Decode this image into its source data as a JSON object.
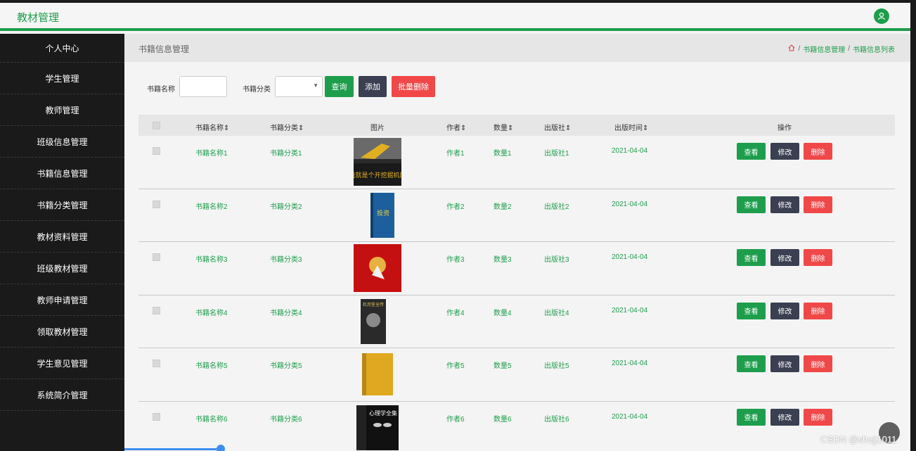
{
  "header": {
    "title": "教材管理"
  },
  "sidebar": {
    "items": [
      "个人中心",
      "学生管理",
      "教师管理",
      "班级信息管理",
      "书籍信息管理",
      "书籍分类管理",
      "教材资料管理",
      "班级教材管理",
      "教师申请管理",
      "领取教材管理",
      "学生意见管理",
      "系统简介管理"
    ]
  },
  "page": {
    "title": "书籍信息管理"
  },
  "breadcrumb": {
    "item1": "书籍信息管理",
    "separator": "/",
    "item2": "书籍信息列表"
  },
  "search": {
    "name_label": "书籍名称",
    "category_label": "书籍分类",
    "query_button": "查询",
    "add_button": "添加",
    "batch_delete_button": "批量删除"
  },
  "table": {
    "headers": [
      "书籍名称⇕",
      "书籍分类⇕",
      "图片",
      "作者⇕",
      "数量⇕",
      "出版社⇕",
      "出版时间⇕",
      "操作"
    ],
    "rows": [
      {
        "name": "书籍名称1",
        "category": "书籍分类1",
        "author": "作者1",
        "qty": "数量1",
        "publisher": "出版社1",
        "date": "2021-04-04",
        "cover_text": "我就是个开挖掘机的"
      },
      {
        "name": "书籍名称2",
        "category": "书籍分类2",
        "author": "作者2",
        "qty": "数量2",
        "publisher": "出版社2",
        "date": "2021-04-04",
        "cover_text": "投资"
      },
      {
        "name": "书籍名称3",
        "category": "书籍分类3",
        "author": "作者3",
        "qty": "数量3",
        "publisher": "出版社3",
        "date": "2021-04-04",
        "cover_text": ""
      },
      {
        "name": "书籍名称4",
        "category": "书籍分类4",
        "author": "作者4",
        "qty": "数量4",
        "publisher": "出版社4",
        "date": "2021-04-04",
        "cover_text": "杜月笙全传"
      },
      {
        "name": "书籍名称5",
        "category": "书籍分类5",
        "author": "作者5",
        "qty": "数量5",
        "publisher": "出版社5",
        "date": "2021-04-04",
        "cover_text": ""
      },
      {
        "name": "书籍名称6",
        "category": "书籍分类6",
        "author": "作者6",
        "qty": "数量6",
        "publisher": "出版社6",
        "date": "2021-04-04",
        "cover_text": "心理学全集"
      }
    ],
    "actions": {
      "view": "查看",
      "edit": "修改",
      "delete": "删除"
    }
  },
  "watermark": "CSDN @shejj1011",
  "colors": {
    "primary": "#1e9e4c",
    "dark": "#3a3f51",
    "danger": "#f04848",
    "sidebar": "#1a1a1a"
  }
}
